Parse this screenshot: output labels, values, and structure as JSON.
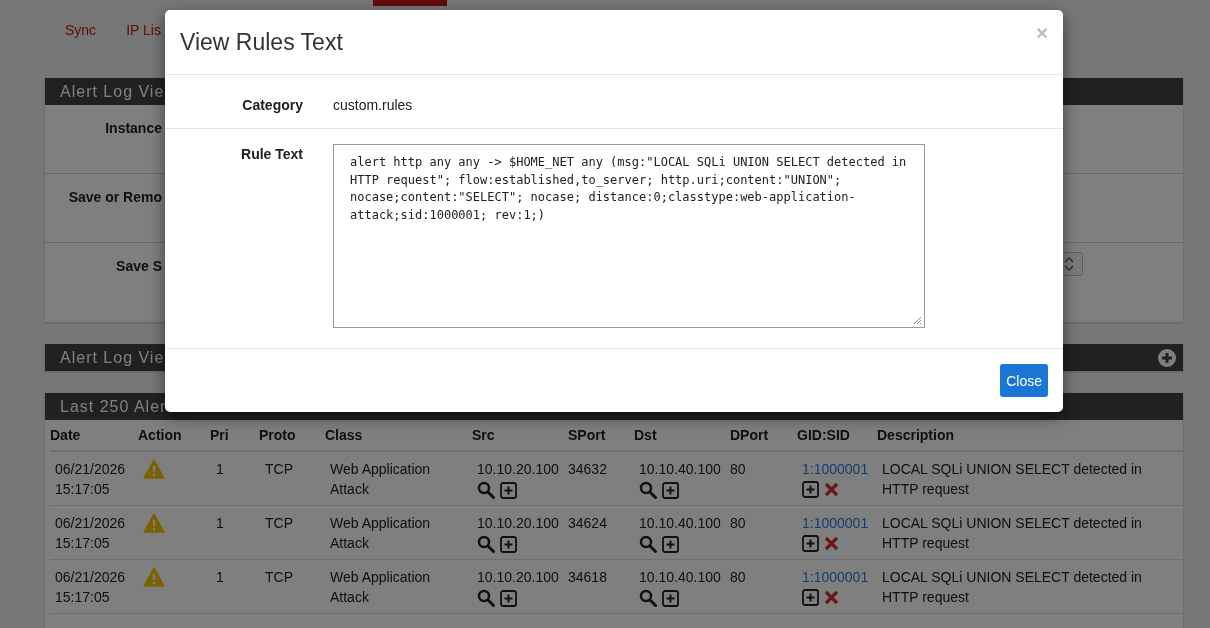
{
  "nav_tabs": [
    {
      "label": "Sync"
    },
    {
      "label": "IP Lis"
    }
  ],
  "settings_panel": {
    "title": "Alert Log Vie",
    "rows": [
      {
        "label": "Instance",
        "kind": "plain"
      },
      {
        "label": "Save or Remo",
        "kind": "plain"
      },
      {
        "label": "Save S",
        "kind": "select"
      }
    ]
  },
  "filter_panel": {
    "title": "Alert Log Vie",
    "expandable": true
  },
  "alerts_panel": {
    "title": "Last 250 Aler",
    "columns": [
      "Date",
      "Action",
      "Pri",
      "Proto",
      "Class",
      "Src",
      "SPort",
      "Dst",
      "DPort",
      "GID:SID",
      "Description"
    ],
    "rows": [
      {
        "date": "06/21/2026",
        "time": "15:17:05",
        "pri": "1",
        "proto": "TCP",
        "class": "Web Application Attack",
        "src": "10.10.20.100",
        "sport": "34632",
        "dst": "10.10.40.100",
        "dport": "80",
        "gid_sid": "1:1000001",
        "description": "LOCAL SQLi UNION SELECT detected in HTTP request"
      },
      {
        "date": "06/21/2026",
        "time": "15:17:05",
        "pri": "1",
        "proto": "TCP",
        "class": "Web Application Attack",
        "src": "10.10.20.100",
        "sport": "34624",
        "dst": "10.10.40.100",
        "dport": "80",
        "gid_sid": "1:1000001",
        "description": "LOCAL SQLi UNION SELECT detected in HTTP request"
      },
      {
        "date": "06/21/2026",
        "time": "15:17:05",
        "pri": "1",
        "proto": "TCP",
        "class": "Web Application Attack",
        "src": "10.10.20.100",
        "sport": "34618",
        "dst": "10.10.40.100",
        "dport": "80",
        "gid_sid": "1:1000001",
        "description": "LOCAL SQLi UNION SELECT detected in HTTP request"
      }
    ]
  },
  "modal": {
    "title": "View Rules Text",
    "close_symbol": "×",
    "fields": [
      {
        "label": "Category",
        "value": "custom.rules",
        "kind": "text"
      },
      {
        "label": "Rule Text",
        "value": "alert http any any -> $HOME_NET any (msg:\"LOCAL SQLi UNION SELECT detected in HTTP request\"; flow:established,to_server; http.uri;content:\"UNION\"; nocase;content:\"SELECT\"; nocase; distance:0;classtype:web-application-attack;sid:1000001; rev:1;)",
        "kind": "textarea"
      }
    ],
    "button": "Close"
  }
}
